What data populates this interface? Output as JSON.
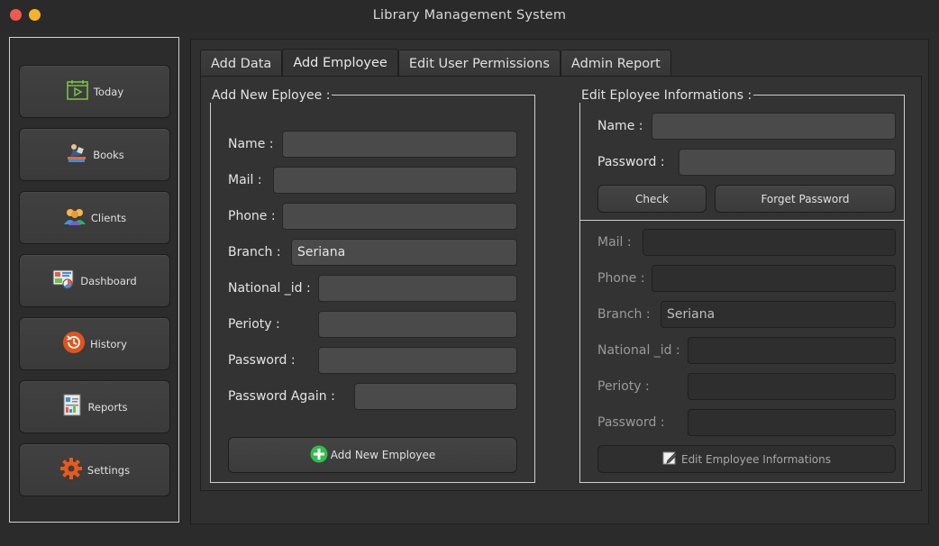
{
  "window": {
    "title": "Library Management System"
  },
  "sidebar": {
    "items": [
      {
        "label": "Today",
        "icon": "calendar-play-icon"
      },
      {
        "label": "Books",
        "icon": "books-reader-icon"
      },
      {
        "label": "Clients",
        "icon": "people-icon"
      },
      {
        "label": "Dashboard",
        "icon": "dashboard-icon"
      },
      {
        "label": "History",
        "icon": "history-icon"
      },
      {
        "label": "Reports",
        "icon": "reports-icon"
      },
      {
        "label": "Settings",
        "icon": "gear-icon"
      }
    ]
  },
  "tabs": [
    {
      "label": "Add Data",
      "active": false
    },
    {
      "label": "Add Employee",
      "active": true
    },
    {
      "label": "Edit User Permissions",
      "active": false
    },
    {
      "label": "Admin Report",
      "active": false
    }
  ],
  "add_employee": {
    "group_title": "Add New Eployee :",
    "name_label": "Name :",
    "name_value": "",
    "mail_label": "Mail :",
    "mail_value": "",
    "phone_label": "Phone :",
    "phone_value": "",
    "branch_label": "Branch :",
    "branch_value": "Seriana",
    "national_id_label": "National _id :",
    "national_id_value": "",
    "periority_label": "Perioty :",
    "periority_value": "",
    "password_label": "Password :",
    "password_value": "",
    "password_again_label": "Password Again :",
    "password_again_value": "",
    "submit_label": "Add New Employee"
  },
  "edit_employee": {
    "group_title": "Edit Eployee Informations :",
    "name_label": "Name :",
    "name_value": "",
    "password_label": "Password :",
    "password_value": "",
    "check_label": "Check",
    "forget_label": "Forget Password",
    "mail_label": "Mail :",
    "mail_value": "",
    "phone_label": "Phone :",
    "phone_value": "",
    "branch_label": "Branch :",
    "branch_value": "Seriana",
    "national_id_label": "National _id :",
    "national_id_value": "",
    "periority_label": "Perioty :",
    "periority_value": "",
    "password2_label": "Password  :",
    "password2_value": "",
    "submit_label": "Edit Employee Informations"
  },
  "colors": {
    "background": "#2b2b2b",
    "panel": "#333333",
    "traffic_red": "#f05a4e",
    "traffic_yellow": "#f5b32a",
    "add_icon_green": "#2fbf4a"
  }
}
